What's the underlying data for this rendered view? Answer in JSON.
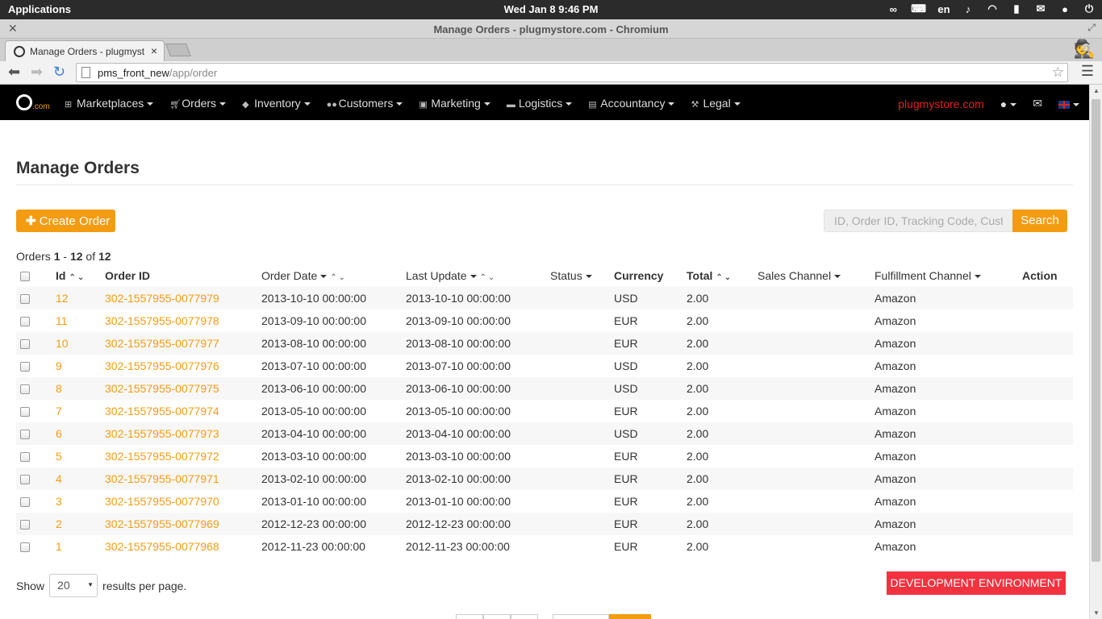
{
  "os": {
    "apps_label": "Applications",
    "clock": "Wed Jan  8  9:46 PM",
    "lang": "en"
  },
  "browser": {
    "window_title": "Manage Orders - plugmystore.com - Chromium",
    "tab_title": "Manage Orders - plugmyst",
    "url_host": "pms_front_new",
    "url_path": "/app/order"
  },
  "nav": {
    "items": [
      {
        "label": "Marketplaces",
        "icon": "sitemap-icon"
      },
      {
        "label": "Orders",
        "icon": "cart-icon"
      },
      {
        "label": "Inventory",
        "icon": "tag-icon"
      },
      {
        "label": "Customers",
        "icon": "users-icon"
      },
      {
        "label": "Marketing",
        "icon": "briefcase-icon"
      },
      {
        "label": "Logistics",
        "icon": "truck-icon"
      },
      {
        "label": "Accountancy",
        "icon": "book-icon"
      },
      {
        "label": "Legal",
        "icon": "gavel-icon"
      }
    ],
    "brand": "plugmystore.com"
  },
  "page": {
    "title": "Manage Orders",
    "create_label": "Create Order",
    "search_placeholder": "ID, Order ID, Tracking Code, Customer",
    "search_label": "Search",
    "count_prefix": "Orders",
    "count_from": "1",
    "count_to": "12",
    "count_of": "of",
    "count_total": "12"
  },
  "table": {
    "columns": {
      "id": "Id",
      "order_id": "Order ID",
      "order_date": "Order Date",
      "last_update": "Last Update",
      "status": "Status",
      "currency": "Currency",
      "total": "Total",
      "sales_channel": "Sales Channel",
      "fulfillment_channel": "Fulfillment Channel",
      "action": "Action"
    },
    "rows": [
      {
        "id": "12",
        "order_id": "302-1557955-0077979",
        "order_date": "2013-10-10 00:00:00",
        "last_update": "2013-10-10 00:00:00",
        "status": "",
        "currency": "USD",
        "total": "2.00",
        "sales_channel": "",
        "fulfillment": "Amazon"
      },
      {
        "id": "11",
        "order_id": "302-1557955-0077978",
        "order_date": "2013-09-10 00:00:00",
        "last_update": "2013-09-10 00:00:00",
        "status": "",
        "currency": "EUR",
        "total": "2.00",
        "sales_channel": "",
        "fulfillment": "Amazon"
      },
      {
        "id": "10",
        "order_id": "302-1557955-0077977",
        "order_date": "2013-08-10 00:00:00",
        "last_update": "2013-08-10 00:00:00",
        "status": "",
        "currency": "EUR",
        "total": "2.00",
        "sales_channel": "",
        "fulfillment": "Amazon"
      },
      {
        "id": "9",
        "order_id": "302-1557955-0077976",
        "order_date": "2013-07-10 00:00:00",
        "last_update": "2013-07-10 00:00:00",
        "status": "",
        "currency": "USD",
        "total": "2.00",
        "sales_channel": "",
        "fulfillment": "Amazon"
      },
      {
        "id": "8",
        "order_id": "302-1557955-0077975",
        "order_date": "2013-06-10 00:00:00",
        "last_update": "2013-06-10 00:00:00",
        "status": "",
        "currency": "USD",
        "total": "2.00",
        "sales_channel": "",
        "fulfillment": "Amazon"
      },
      {
        "id": "7",
        "order_id": "302-1557955-0077974",
        "order_date": "2013-05-10 00:00:00",
        "last_update": "2013-05-10 00:00:00",
        "status": "",
        "currency": "EUR",
        "total": "2.00",
        "sales_channel": "",
        "fulfillment": "Amazon"
      },
      {
        "id": "6",
        "order_id": "302-1557955-0077973",
        "order_date": "2013-04-10 00:00:00",
        "last_update": "2013-04-10 00:00:00",
        "status": "",
        "currency": "USD",
        "total": "2.00",
        "sales_channel": "",
        "fulfillment": "Amazon"
      },
      {
        "id": "5",
        "order_id": "302-1557955-0077972",
        "order_date": "2013-03-10 00:00:00",
        "last_update": "2013-03-10 00:00:00",
        "status": "",
        "currency": "EUR",
        "total": "2.00",
        "sales_channel": "",
        "fulfillment": "Amazon"
      },
      {
        "id": "4",
        "order_id": "302-1557955-0077971",
        "order_date": "2013-02-10 00:00:00",
        "last_update": "2013-02-10 00:00:00",
        "status": "",
        "currency": "EUR",
        "total": "2.00",
        "sales_channel": "",
        "fulfillment": "Amazon"
      },
      {
        "id": "3",
        "order_id": "302-1557955-0077970",
        "order_date": "2013-01-10 00:00:00",
        "last_update": "2013-01-10 00:00:00",
        "status": "",
        "currency": "EUR",
        "total": "2.00",
        "sales_channel": "",
        "fulfillment": "Amazon"
      },
      {
        "id": "2",
        "order_id": "302-1557955-0077969",
        "order_date": "2012-12-23 00:00:00",
        "last_update": "2012-12-23 00:00:00",
        "status": "",
        "currency": "EUR",
        "total": "2.00",
        "sales_channel": "",
        "fulfillment": "Amazon"
      },
      {
        "id": "1",
        "order_id": "302-1557955-0077968",
        "order_date": "2012-11-23 00:00:00",
        "last_update": "2012-11-23 00:00:00",
        "status": "",
        "currency": "EUR",
        "total": "2.00",
        "sales_channel": "",
        "fulfillment": "Amazon"
      }
    ]
  },
  "footer": {
    "show_label": "Show",
    "per_page": "20",
    "per_page_suffix": "results per page.",
    "env_badge": "DEVELOPMENT ENVIRONMENT"
  },
  "colors": {
    "accent": "#f39c12",
    "nav_bg": "#000000",
    "brand": "#e0231c",
    "env_badge": "#f2323f"
  }
}
